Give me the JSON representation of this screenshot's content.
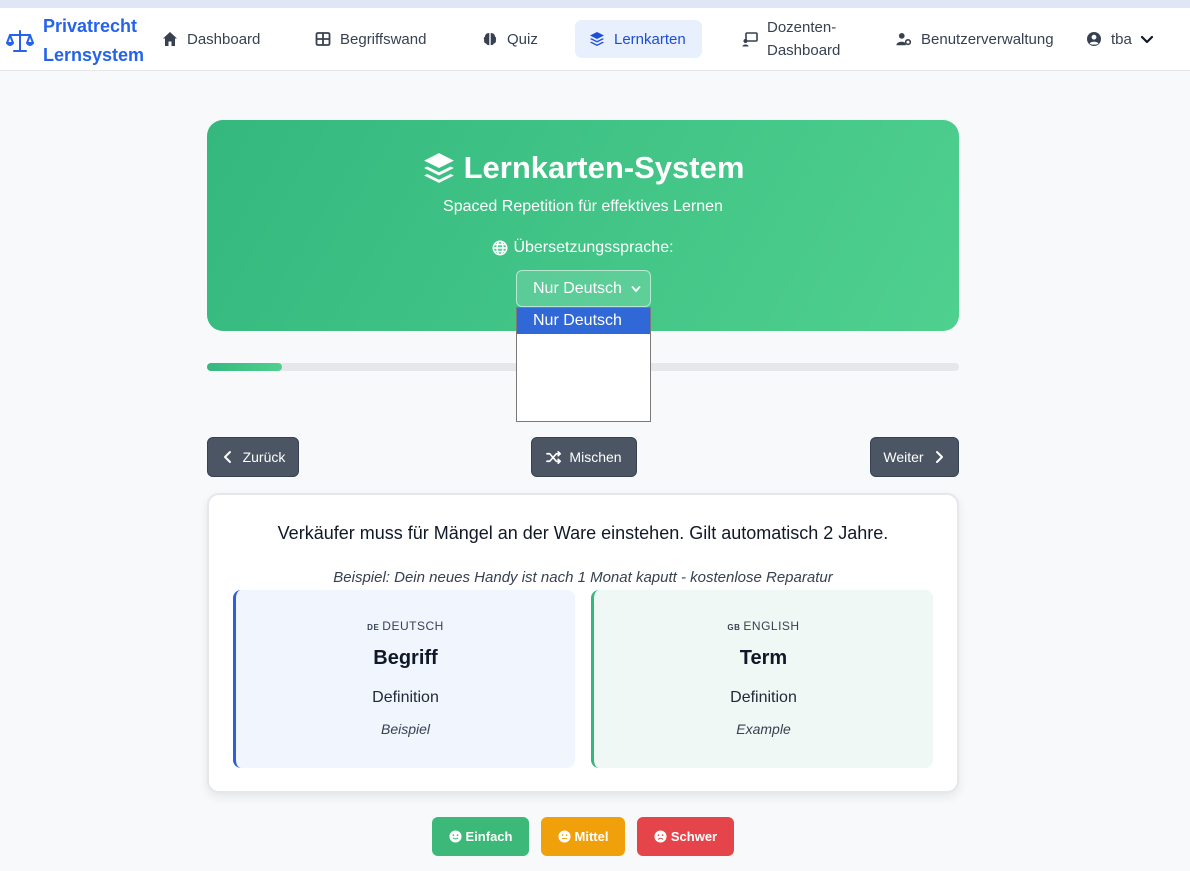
{
  "app": {
    "brand_line1": "Privatrecht",
    "brand_line2": "Lernsystem",
    "accent": "#2563eb"
  },
  "nav": {
    "dashboard": "Dashboard",
    "begriffswand": "Begriffswand",
    "quiz": "Quiz",
    "lernkarten": "Lernkarten",
    "dozenten_line1": "Dozenten-",
    "dozenten_line2": "Dashboard",
    "benutzerverwaltung": "Benutzerverwaltung",
    "user": "tba",
    "active": "Lernkarten"
  },
  "hero": {
    "title": "Lernkarten-System",
    "subtitle": "Spaced Repetition für effektives Lernen",
    "language_label": "Übersetzungssprache:",
    "selected_language": "Nur Deutsch",
    "dropdown_options": [
      "Nur Deutsch"
    ],
    "colors": {
      "from": "#34b87e",
      "to": "#4fd08f"
    }
  },
  "progress": {
    "fraction": 0.1
  },
  "controls": {
    "back": "Zurück",
    "shuffle": "Mischen",
    "next": "Weiter"
  },
  "card": {
    "text": "Verkäufer muss für Mängel an der Ware einstehen. Gilt automatisch 2 Jahre.",
    "example": "Beispiel: Dein neues Handy ist nach 1 Monat kaputt - kostenlose Reparatur",
    "german": {
      "flag": "DE",
      "header": "DEUTSCH",
      "term": "Begriff",
      "definition": "Definition",
      "example": "Beispiel"
    },
    "english": {
      "flag": "GB",
      "header": "ENGLISH",
      "term": "Term",
      "definition": "Definition",
      "example": "Example"
    }
  },
  "rating": {
    "easy": "Einfach",
    "medium": "Mittel",
    "hard": "Schwer",
    "colors": {
      "easy": "#3cb878",
      "medium": "#f0a00a",
      "hard": "#e5454a"
    }
  }
}
